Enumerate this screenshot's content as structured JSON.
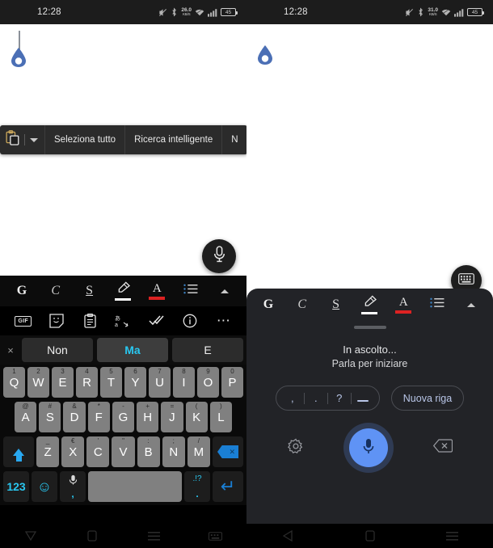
{
  "statusbar": {
    "left": {
      "time": "12:28",
      "network_speed": "26.0",
      "network_unit": "KB/S",
      "battery": "45",
      "icons": [
        "mute-icon",
        "bluetooth-icon",
        "network-speed",
        "wifi-icon",
        "signal-icon",
        "battery-icon"
      ]
    },
    "right": {
      "time": "12:28",
      "network_speed": "31.0",
      "network_unit": "KB/S",
      "battery": "45",
      "icons": [
        "mute-icon",
        "bluetooth-icon",
        "network-speed",
        "wifi-icon",
        "signal-icon",
        "battery-icon"
      ]
    }
  },
  "context_menu": {
    "paste_icon": "clipboard-paste-icon",
    "expand_icon": "chevron-down-icon",
    "items": [
      {
        "label": "Seleziona tutto"
      },
      {
        "label": "Ricerca intelligente"
      },
      {
        "label": "N"
      }
    ]
  },
  "floating_mic": {
    "icon": "microphone-icon"
  },
  "keyboard_toggle": {
    "icon": "keyboard-icon"
  },
  "format_toolbar": {
    "items": [
      {
        "label": "G",
        "name": "bold-button"
      },
      {
        "label": "C",
        "name": "italic-button"
      },
      {
        "label": "S",
        "name": "underline-button"
      },
      {
        "label": "",
        "name": "highlighter-button"
      },
      {
        "label": "A",
        "name": "text-color-button"
      },
      {
        "label": "",
        "name": "list-button"
      },
      {
        "label": "",
        "name": "collapse-button"
      }
    ],
    "highlight_color": "#ffffff",
    "text_color": "#dd2222"
  },
  "tool_row": {
    "items": [
      {
        "name": "gif-icon",
        "label": "GIF"
      },
      {
        "name": "sticker-icon",
        "label": ""
      },
      {
        "name": "clipboard-icon",
        "label": ""
      },
      {
        "name": "translate-icon",
        "label": ""
      },
      {
        "name": "spellcheck-icon",
        "label": ""
      },
      {
        "name": "info-icon",
        "label": ""
      },
      {
        "name": "more-options-icon",
        "label": "⋯"
      }
    ]
  },
  "suggestions": {
    "close_label": "×",
    "items": [
      {
        "label": "Non",
        "selected": false
      },
      {
        "label": "Ma",
        "selected": true
      },
      {
        "label": "E",
        "selected": false
      }
    ],
    "selected_color": "#29c7f0"
  },
  "keyboard": {
    "row1": [
      {
        "key": "Q",
        "hint": "1"
      },
      {
        "key": "W",
        "hint": "2"
      },
      {
        "key": "E",
        "hint": "3"
      },
      {
        "key": "R",
        "hint": "4"
      },
      {
        "key": "T",
        "hint": "5"
      },
      {
        "key": "Y",
        "hint": "6"
      },
      {
        "key": "U",
        "hint": "7"
      },
      {
        "key": "I",
        "hint": "8"
      },
      {
        "key": "O",
        "hint": "9"
      },
      {
        "key": "P",
        "hint": "0"
      }
    ],
    "row2": [
      {
        "key": "A",
        "hint": "@"
      },
      {
        "key": "S",
        "hint": "#"
      },
      {
        "key": "D",
        "hint": "&"
      },
      {
        "key": "F",
        "hint": "*"
      },
      {
        "key": "G",
        "hint": "-"
      },
      {
        "key": "H",
        "hint": "+"
      },
      {
        "key": "J",
        "hint": "="
      },
      {
        "key": "K",
        "hint": "("
      },
      {
        "key": "L",
        "hint": ")"
      }
    ],
    "row3": [
      {
        "key": "Z",
        "hint": "_"
      },
      {
        "key": "X",
        "hint": "€"
      },
      {
        "key": "C",
        "hint": "'"
      },
      {
        "key": "V",
        "hint": "\""
      },
      {
        "key": "B",
        "hint": ":"
      },
      {
        "key": "N",
        "hint": ";"
      },
      {
        "key": "M",
        "hint": "/"
      }
    ],
    "shift_label": "shift-key",
    "backspace_label": "backspace-key",
    "numeric_label": "123",
    "emoji_label": "☺",
    "mic_key_hint": ",",
    "space_label": "",
    "punct_label": ".!?",
    "punct_hint": ".",
    "enter_label": "enter-key",
    "accent_color": "#29c7f0",
    "enter_color": "#1a7fd4"
  },
  "voice_panel": {
    "listening_title": "In ascolto...",
    "listening_subtitle": "Parla per iniziare",
    "punctuation": [
      {
        "label": ",",
        "name": "comma-key"
      },
      {
        "label": ".",
        "name": "period-key"
      },
      {
        "label": "?",
        "name": "question-key"
      },
      {
        "label": "",
        "name": "space-key"
      }
    ],
    "newline_label": "Nuova riga",
    "settings_icon": "gear-icon",
    "mic_icon": "microphone-icon",
    "backspace_icon": "backspace-icon",
    "mic_color": "#5f93f5"
  },
  "navbar": {
    "left": [
      {
        "name": "nav-back-button",
        "icon": "triangle-down-icon"
      },
      {
        "name": "nav-home-button",
        "icon": "square-icon"
      },
      {
        "name": "nav-recents-button",
        "icon": "menu-icon"
      },
      {
        "name": "nav-keyboard-indicator",
        "icon": "keyboard-icon"
      }
    ],
    "right": [
      {
        "name": "nav-back-button",
        "icon": "triangle-left-icon"
      },
      {
        "name": "nav-home-button",
        "icon": "square-icon"
      },
      {
        "name": "nav-recents-button",
        "icon": "menu-icon"
      }
    ]
  }
}
